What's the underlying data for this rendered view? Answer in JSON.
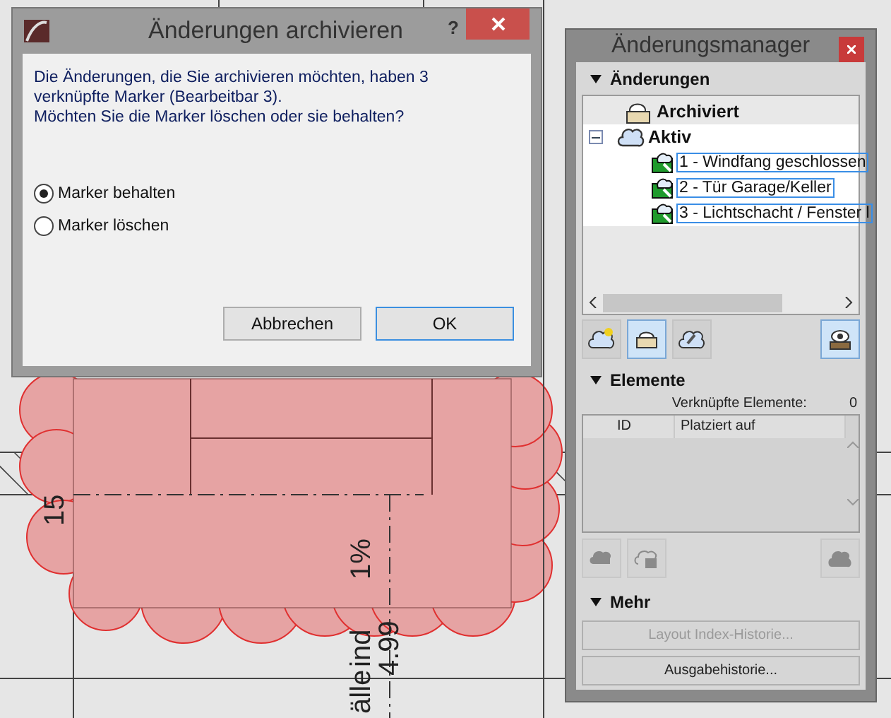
{
  "drawing": {
    "labels": [
      {
        "text": "15",
        "kind": "vertical"
      },
      {
        "text": "1%",
        "kind": "vertical"
      },
      {
        "text": "ind",
        "kind": "vertical"
      },
      {
        "text": "4.99",
        "kind": "vertical"
      },
      {
        "text": "älle",
        "kind": "vertical"
      }
    ]
  },
  "dialog": {
    "title": "Änderungen archivieren",
    "help": "?",
    "message": [
      "Die Änderungen, die Sie archivieren möchten, haben 3 verknüpfte Marker (Bearbeitbar 3).",
      "Möchten Sie die Marker löschen oder sie behalten?"
    ],
    "options": [
      {
        "label": "Marker behalten",
        "selected": true
      },
      {
        "label": "Marker löschen",
        "selected": false
      }
    ],
    "buttons": [
      {
        "label": "Abbrechen",
        "default": false
      },
      {
        "label": "OK",
        "default": true
      }
    ]
  },
  "panel": {
    "title": "Änderungsmanager",
    "changes": {
      "heading": "Änderungen",
      "expanded": true,
      "tree": [
        {
          "label": "Archiviert",
          "kind": "archive",
          "selected": false
        },
        {
          "label": "Aktiv",
          "kind": "active",
          "selected": false,
          "expanded": true,
          "children": [
            {
              "label": "1 - Windfang geschlossen",
              "kind": "change",
              "selected": true
            },
            {
              "label": "2 - Tür Garage/Keller",
              "kind": "change",
              "selected": true
            },
            {
              "label": "3 - Lichtschacht / Fenster l",
              "kind": "change",
              "selected": true
            }
          ]
        }
      ],
      "tools": [
        {
          "kind": "new",
          "pressed": false
        },
        {
          "kind": "archive",
          "pressed": true
        },
        {
          "kind": "link",
          "pressed": false
        },
        {
          "kind": "eye",
          "pressed": true
        }
      ]
    },
    "elements": {
      "heading": "Elemente",
      "expanded": true,
      "count_label": "Verknüpfte Elemente:",
      "count": "0",
      "columns": [
        "ID",
        "Platziert auf"
      ]
    },
    "more": {
      "heading": "Mehr",
      "expanded": true,
      "buttons": [
        {
          "label": "Layout Index-Historie...",
          "disabled": true
        },
        {
          "label": "Ausgabehistorie...",
          "disabled": false
        }
      ]
    }
  }
}
